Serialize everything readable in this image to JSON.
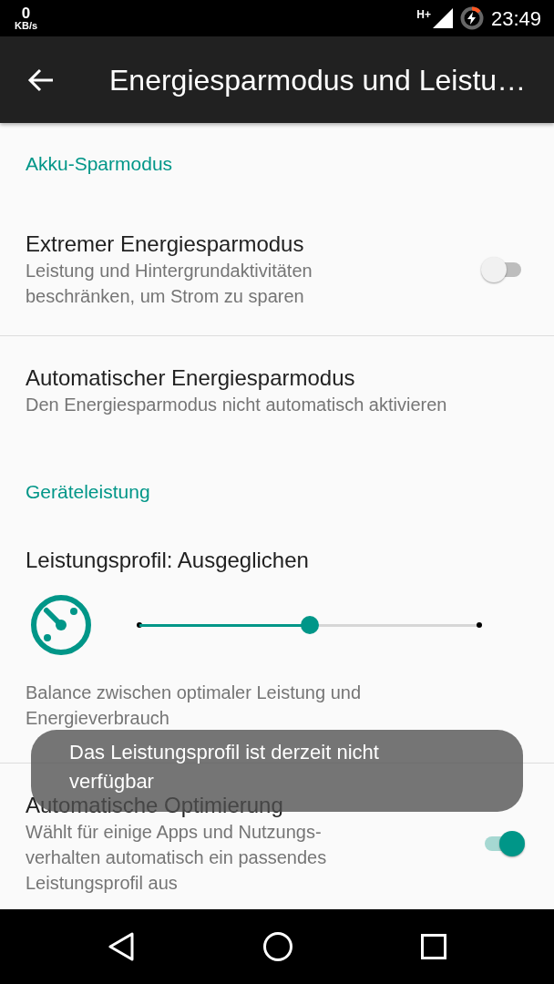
{
  "status_bar": {
    "net_speed": "0",
    "net_unit": "KB/s",
    "network": "H+",
    "time": "23:49"
  },
  "toolbar": {
    "title": "Energiesparmodus und Leistu…"
  },
  "sections": [
    {
      "header": "Akku-Sparmodus",
      "items": [
        {
          "kind": "switch",
          "title": "Extremer Energiesparmodus",
          "summary": "Leistung und Hintergrundaktivitäten beschränken, um Strom zu sparen",
          "on": false
        },
        {
          "kind": "text",
          "title": "Automatischer Energiesparmodus",
          "summary": "Den Energiesparmodus nicht automatisch aktivieren"
        }
      ]
    },
    {
      "header": "Geräteleistung",
      "items": [
        {
          "kind": "slider",
          "title": "Leistungsprofil: Ausgeglichen",
          "level": 0.5,
          "summary": "Balance zwischen optimaler Leistung und Energieverbrauch"
        },
        {
          "kind": "switch",
          "title": "Automatische Optimierung",
          "summary": "Wählt für einige Apps und Nutzungs-verhalten automatisch ein passendes Leistungsprofil aus",
          "on": true
        }
      ]
    }
  ],
  "toast": {
    "text": "Das Leistungsprofil ist derzeit nicht verfügbar"
  }
}
